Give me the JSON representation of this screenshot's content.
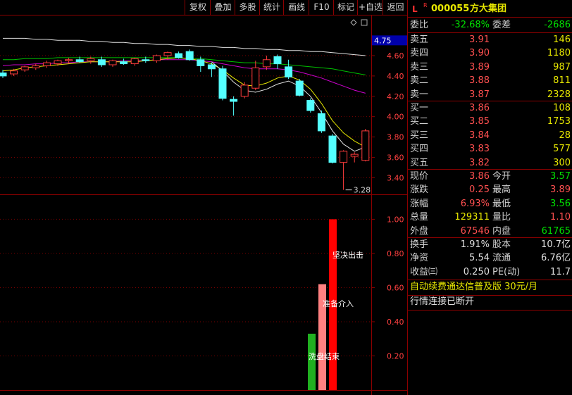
{
  "toolbar": {
    "items": [
      "复权",
      "叠加",
      "多股",
      "统计",
      "画线",
      "F10",
      "标记",
      "+自选",
      "返回"
    ]
  },
  "chart": {
    "price_axis": [
      "4.60",
      "4.40",
      "4.20",
      "4.00",
      "3.80",
      "3.60",
      "3.40"
    ],
    "current_price_tag": "4.75",
    "low_marker": "3.28",
    "indicator_axis": [
      "1.00",
      "0.80",
      "0.60",
      "0.40",
      "0.20"
    ],
    "bar_labels": {
      "decisive": "坚决出击",
      "prepare": "准备介入",
      "washout": "洗盘结束"
    },
    "chart_data": {
      "type": "candlestick",
      "ylim": [
        3.25,
        4.87
      ],
      "candles": [
        {
          "o": 4.43,
          "h": 4.46,
          "l": 4.38,
          "c": 4.4
        },
        {
          "o": 4.42,
          "h": 4.47,
          "l": 4.4,
          "c": 4.45
        },
        {
          "o": 4.46,
          "h": 4.5,
          "l": 4.44,
          "c": 4.49
        },
        {
          "o": 4.48,
          "h": 4.52,
          "l": 4.46,
          "c": 4.5
        },
        {
          "o": 4.5,
          "h": 4.55,
          "l": 4.48,
          "c": 4.53
        },
        {
          "o": 4.52,
          "h": 4.56,
          "l": 4.5,
          "c": 4.55
        },
        {
          "o": 4.55,
          "h": 4.58,
          "l": 4.52,
          "c": 4.56
        },
        {
          "o": 4.56,
          "h": 4.59,
          "l": 4.53,
          "c": 4.54
        },
        {
          "o": 4.55,
          "h": 4.59,
          "l": 4.52,
          "c": 4.57
        },
        {
          "o": 4.56,
          "h": 4.59,
          "l": 4.49,
          "c": 4.51
        },
        {
          "o": 4.51,
          "h": 4.56,
          "l": 4.49,
          "c": 4.55
        },
        {
          "o": 4.54,
          "h": 4.57,
          "l": 4.51,
          "c": 4.52
        },
        {
          "o": 4.52,
          "h": 4.58,
          "l": 4.5,
          "c": 4.57
        },
        {
          "o": 4.56,
          "h": 4.59,
          "l": 4.53,
          "c": 4.55
        },
        {
          "o": 4.55,
          "h": 4.61,
          "l": 4.53,
          "c": 4.6
        },
        {
          "o": 4.6,
          "h": 4.64,
          "l": 4.56,
          "c": 4.63
        },
        {
          "o": 4.62,
          "h": 4.64,
          "l": 4.57,
          "c": 4.58
        },
        {
          "o": 4.64,
          "h": 4.66,
          "l": 4.55,
          "c": 4.56
        },
        {
          "o": 4.56,
          "h": 4.59,
          "l": 4.44,
          "c": 4.5
        },
        {
          "o": 4.51,
          "h": 4.53,
          "l": 4.39,
          "c": 4.47
        },
        {
          "o": 4.47,
          "h": 4.5,
          "l": 4.16,
          "c": 4.18
        },
        {
          "o": 4.17,
          "h": 4.2,
          "l": 4.01,
          "c": 4.15
        },
        {
          "o": 4.2,
          "h": 4.34,
          "l": 4.18,
          "c": 4.31
        },
        {
          "o": 4.28,
          "h": 4.55,
          "l": 4.26,
          "c": 4.48
        },
        {
          "o": 4.49,
          "h": 4.6,
          "l": 4.46,
          "c": 4.56
        },
        {
          "o": 4.59,
          "h": 4.61,
          "l": 4.47,
          "c": 4.52
        },
        {
          "o": 4.49,
          "h": 4.56,
          "l": 4.37,
          "c": 4.39
        },
        {
          "o": 4.35,
          "h": 4.37,
          "l": 4.2,
          "c": 4.21
        },
        {
          "o": 4.16,
          "h": 4.18,
          "l": 4.04,
          "c": 4.06
        },
        {
          "o": 4.03,
          "h": 4.06,
          "l": 3.84,
          "c": 3.86
        },
        {
          "o": 3.81,
          "h": 3.83,
          "l": 3.54,
          "c": 3.55
        },
        {
          "o": 3.55,
          "h": 3.67,
          "l": 3.28,
          "c": 3.66
        },
        {
          "o": 3.61,
          "h": 3.65,
          "l": 3.55,
          "c": 3.63
        },
        {
          "o": 3.57,
          "h": 3.88,
          "l": 3.56,
          "c": 3.86
        }
      ],
      "moving_averages": [
        {
          "name": "",
          "color": "#e0e0e0",
          "values": [
            4.77,
            4.77,
            4.77,
            4.76,
            4.76,
            4.75,
            4.75,
            4.75,
            4.74,
            4.74,
            4.73,
            4.73,
            4.72,
            4.72,
            4.71,
            4.71,
            4.7,
            4.7,
            4.69,
            4.69,
            4.68,
            4.68,
            4.67,
            4.67,
            4.66,
            4.66,
            4.65,
            4.65,
            4.64,
            4.64,
            4.63,
            4.62,
            4.61,
            4.6
          ]
        },
        {
          "name": "",
          "color": "#00c000",
          "values": [
            4.56,
            4.56,
            4.57,
            4.57,
            4.57,
            4.58,
            4.58,
            4.58,
            4.58,
            4.58,
            4.58,
            4.58,
            4.58,
            4.58,
            4.58,
            4.58,
            4.58,
            4.57,
            4.57,
            4.56,
            4.55,
            4.54,
            4.53,
            4.53,
            4.52,
            4.52,
            4.51,
            4.5,
            4.49,
            4.48,
            4.47,
            4.45,
            4.43,
            4.41
          ]
        },
        {
          "name": "",
          "color": "#cc00cc",
          "values": [
            4.5,
            4.51,
            4.51,
            4.52,
            4.52,
            4.53,
            4.53,
            4.54,
            4.54,
            4.54,
            4.54,
            4.55,
            4.55,
            4.55,
            4.56,
            4.56,
            4.56,
            4.56,
            4.55,
            4.54,
            4.52,
            4.5,
            4.48,
            4.47,
            4.47,
            4.47,
            4.46,
            4.44,
            4.41,
            4.38,
            4.34,
            4.3,
            4.26,
            4.23
          ]
        },
        {
          "name": "",
          "color": "#e8e800",
          "values": [
            4.45,
            4.46,
            4.48,
            4.49,
            4.5,
            4.51,
            4.52,
            4.53,
            4.54,
            4.54,
            4.54,
            4.54,
            4.54,
            4.55,
            4.56,
            4.57,
            4.58,
            4.57,
            4.55,
            4.52,
            4.46,
            4.38,
            4.31,
            4.3,
            4.33,
            4.38,
            4.4,
            4.36,
            4.27,
            4.13,
            3.96,
            3.84,
            3.76,
            3.7
          ]
        },
        {
          "name": "",
          "color": "#e0e0e0",
          "values": [
            null,
            null,
            null,
            null,
            null,
            null,
            null,
            null,
            null,
            null,
            null,
            null,
            null,
            null,
            null,
            null,
            null,
            null,
            null,
            4.54,
            4.45,
            4.34,
            4.26,
            4.24,
            4.27,
            4.32,
            4.35,
            4.3,
            4.2,
            4.04,
            3.86,
            3.73,
            3.66,
            3.7
          ]
        }
      ],
      "indicator": {
        "ylim": [
          0,
          1.08
        ],
        "bars": [
          {
            "name": "washout",
            "value": 0.33,
            "color": "#20b020"
          },
          {
            "name": "prepare",
            "value": 0.62,
            "color": "#ff8080"
          },
          {
            "name": "decisive",
            "value": 1.0,
            "color": "#ff0000"
          }
        ]
      }
    }
  },
  "quote": {
    "header": {
      "l": "L",
      "r": "R",
      "code": "000055",
      "name": "方大集团"
    },
    "ratio": {
      "label": "委比",
      "value": "-32.68%",
      "diff_label": "委差",
      "diff": "-2686"
    },
    "asks": [
      {
        "label": "卖五",
        "price": "3.91",
        "vol": "146"
      },
      {
        "label": "卖四",
        "price": "3.90",
        "vol": "1180"
      },
      {
        "label": "卖三",
        "price": "3.89",
        "vol": "987"
      },
      {
        "label": "卖二",
        "price": "3.88",
        "vol": "811"
      },
      {
        "label": "卖一",
        "price": "3.87",
        "vol": "2328"
      }
    ],
    "bids": [
      {
        "label": "买一",
        "price": "3.86",
        "vol": "108"
      },
      {
        "label": "买二",
        "price": "3.85",
        "vol": "1753"
      },
      {
        "label": "买三",
        "price": "3.84",
        "vol": "28"
      },
      {
        "label": "买四",
        "price": "3.83",
        "vol": "577"
      },
      {
        "label": "买五",
        "price": "3.82",
        "vol": "300"
      }
    ],
    "stats": [
      {
        "l1": "现价",
        "v1": "3.86",
        "c1": "red",
        "l2": "今开",
        "v2": "3.57",
        "c2": "green"
      },
      {
        "l1": "涨跌",
        "v1": "0.25",
        "c1": "red",
        "l2": "最高",
        "v2": "3.89",
        "c2": "red"
      },
      {
        "l1": "涨幅",
        "v1": "6.93%",
        "c1": "red",
        "l2": "最低",
        "v2": "3.56",
        "c2": "green"
      },
      {
        "l1": "总量",
        "v1": "129311",
        "c1": "yellow",
        "l2": "量比",
        "v2": "1.10",
        "c2": "red"
      },
      {
        "l1": "外盘",
        "v1": "67546",
        "c1": "red",
        "l2": "内盘",
        "v2": "61765",
        "c2": "green"
      }
    ],
    "fundamentals": [
      {
        "l1": "换手",
        "v1": "1.91%",
        "l2": "股本",
        "v2": "10.7亿"
      },
      {
        "l1": "净资",
        "v1": "5.54",
        "l2": "流通",
        "v2": "6.76亿"
      },
      {
        "l1": "收益㈢",
        "v1": "0.250",
        "l2": "PE(动)",
        "v2": "11.7"
      }
    ],
    "promo": "自动续费通达信普及版  30元/月",
    "status": "行情连接已断开"
  }
}
